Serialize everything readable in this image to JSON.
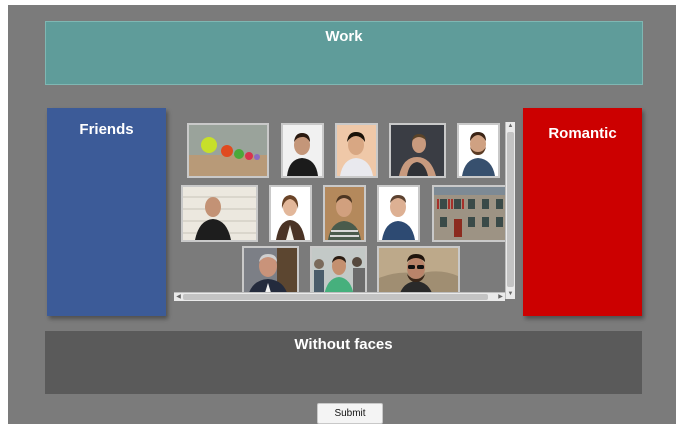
{
  "zones": {
    "work": "Work",
    "friends": "Friends",
    "romantic": "Romantic",
    "without_faces": "Without faces"
  },
  "submit_label": "Submit",
  "photos": [
    "lollipop-figurines",
    "man-black-jacket",
    "man-gray-shirt",
    "man-tank-top",
    "man-beard-smiling",
    "bald-man-black-shirt",
    "woman-blazer",
    "man-striped-sweater",
    "man-blue-sweater",
    "brick-house",
    "older-man-suit",
    "man-green-tshirt-crowd",
    "man-sunglasses-rock"
  ],
  "colors": {
    "work": "#5f9c9a",
    "friends": "#3c5b98",
    "romantic": "#cc0000",
    "without_faces": "#5a5a5a",
    "background": "#7b7b7b"
  }
}
